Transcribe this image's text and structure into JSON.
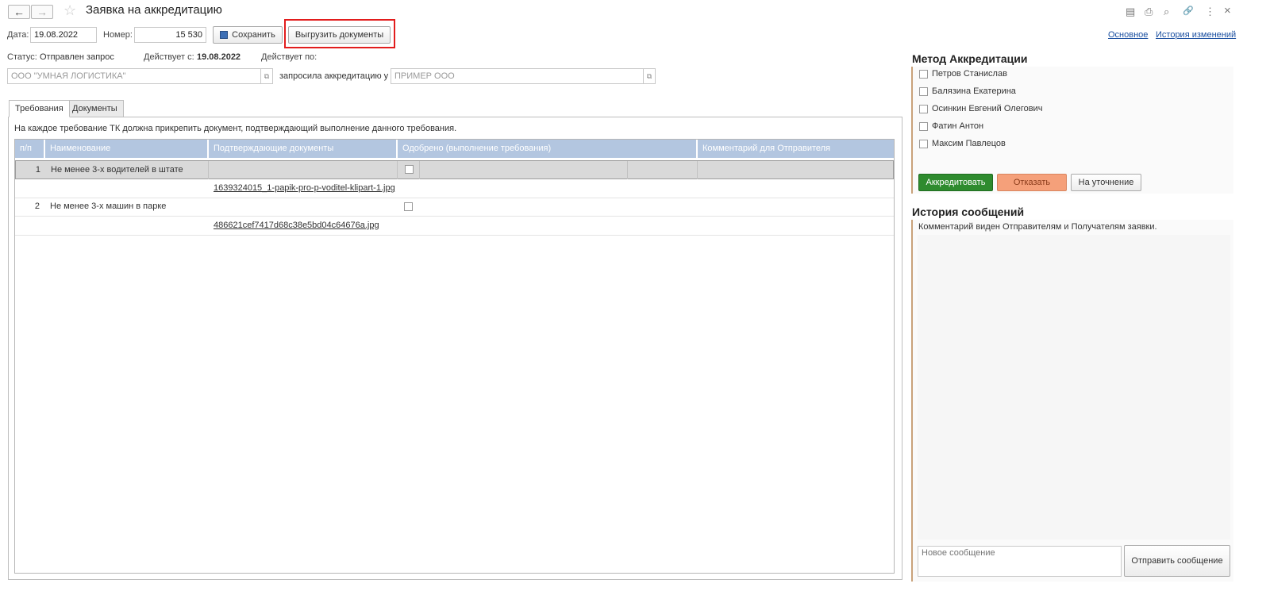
{
  "header": {
    "back_label": "←",
    "forward_label": "→",
    "star": "☆",
    "title": "Заявка на аккредитацию",
    "icons": [
      "save-icon",
      "print-icon",
      "preview-icon",
      "link-icon",
      "more-icon",
      "close-icon"
    ],
    "icon_glyphs": [
      "▤",
      "⎙",
      "⌕",
      "🔗",
      "⋮",
      "×"
    ]
  },
  "toolbar": {
    "date_label": "Дата:",
    "date_value": "19.08.2022",
    "number_label": "Номер:",
    "number_value": "15 530",
    "save_label": "Сохранить",
    "export_label": "Выгрузить документы",
    "links": [
      "Основное",
      "История изменений"
    ]
  },
  "status": {
    "status_label": "Статус:",
    "status_value": "Отправлен запрос",
    "valid_from_label": "Действует с:",
    "valid_from_value": "19.08.2022",
    "valid_to_label": "Действует по:"
  },
  "parties": {
    "sender_value": "ООО \"УМНАЯ ЛОГИСТИКА\"",
    "relation_label": "запросила аккредитацию у",
    "receiver_value": "ПРИМЕР ООО",
    "open_glyph": "⧉"
  },
  "tabs": [
    {
      "label": "Требования",
      "active": true
    },
    {
      "label": "Документы",
      "active": false
    }
  ],
  "requirements": {
    "hint": "На каждое требование ТК должна прикрепить документ, подтверждающий выполнение данного требования.",
    "columns": [
      "п/п",
      "Наименование",
      "Подтверждающие документы",
      "Одобрено (выполнение требования)",
      "Комментарий для Отправителя"
    ],
    "rows": [
      {
        "num": "1",
        "name": "Не менее 3-х водителей в штате",
        "document": "1639324015_1-papik-pro-p-voditel-klipart-1.jpg",
        "approved": false
      },
      {
        "num": "2",
        "name": "Не менее 3-х машин в парке",
        "document": "486621cef7417d68c38e5bd04c64676a.jpg",
        "approved": false
      }
    ]
  },
  "accreditation": {
    "title": "Метод Аккредитации",
    "people": [
      "Петров Станислав",
      "Балязина Екатерина",
      "Осинкин Евгений Олегович",
      "Фатин Антон",
      "Максим Павлецов"
    ],
    "accredit_label": "Аккредитовать",
    "reject_label": "Отказать",
    "clarify_label": "На уточнение",
    "colors": {
      "accredit": "#2e8b2e",
      "reject": "#f5a07a",
      "clarify": "#f0f0f0"
    }
  },
  "messages": {
    "title": "История сообщений",
    "note": "Комментарий виден Отправителям и Получателям заявки.",
    "new_message_placeholder": "Новое сообщение",
    "send_label": "Отправить сообщение"
  }
}
